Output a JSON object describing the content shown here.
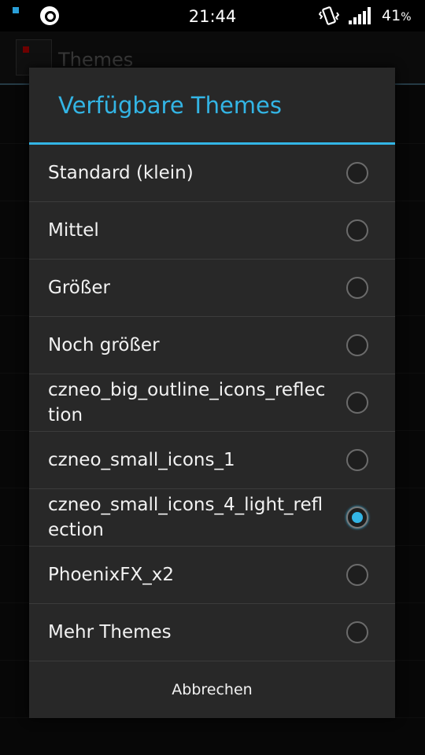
{
  "statusbar": {
    "time": "21:44",
    "battery": "41",
    "battery_unit": "%",
    "icons": [
      "notification-dot-icon",
      "app-notification-icon",
      "vibrate-icon",
      "signal-icon"
    ],
    "accent": "#2a9fd8"
  },
  "background_app": {
    "title": "Themes"
  },
  "dialog": {
    "title": "Verfügbare Themes",
    "accent": "#33b5e5",
    "options": [
      {
        "label": "Standard (klein)",
        "checked": false
      },
      {
        "label": "Mittel",
        "checked": false
      },
      {
        "label": "Größer",
        "checked": false
      },
      {
        "label": "Noch größer",
        "checked": false
      },
      {
        "label": "czneo_big_outline_icons_reflection",
        "checked": false
      },
      {
        "label": "czneo_small_icons_1",
        "checked": false
      },
      {
        "label": "czneo_small_icons_4_light_reflection",
        "checked": true
      },
      {
        "label": "PhoenixFX_x2",
        "checked": false
      },
      {
        "label": "Mehr Themes",
        "checked": false
      }
    ],
    "cancel_label": "Abbrechen"
  }
}
